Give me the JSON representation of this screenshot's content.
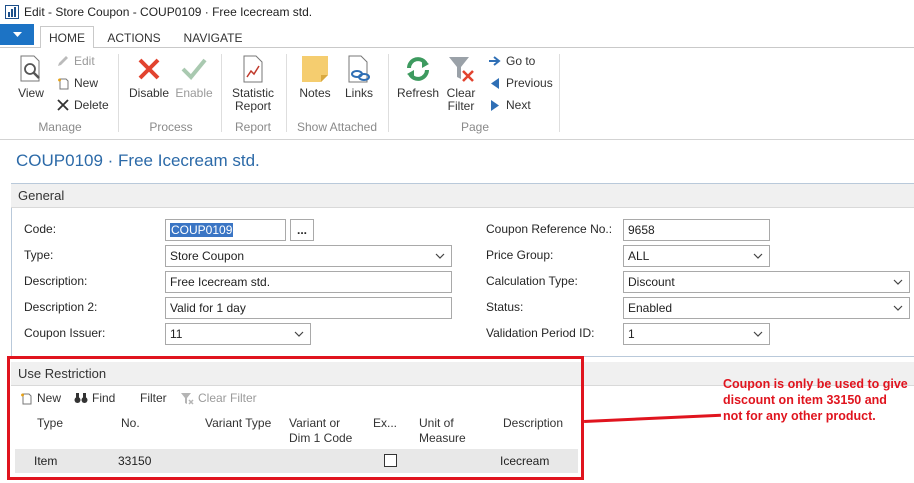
{
  "window": {
    "title": "Edit - Store Coupon - COUP0109 · Free Icecream std."
  },
  "tabs": [
    "HOME",
    "ACTIONS",
    "NAVIGATE"
  ],
  "ribbon": {
    "manage": {
      "view": "View",
      "edit": "Edit",
      "new": "New",
      "delete": "Delete",
      "group": "Manage"
    },
    "process": {
      "disable": "Disable",
      "enable": "Enable",
      "group": "Process"
    },
    "report": {
      "statistic_line1": "Statistic",
      "statistic_line2": "Report",
      "group": "Report"
    },
    "attached": {
      "notes": "Notes",
      "links": "Links",
      "group": "Show Attached"
    },
    "page": {
      "refresh": "Refresh",
      "clear_line1": "Clear",
      "clear_line2": "Filter",
      "goto": "Go to",
      "previous": "Previous",
      "next": "Next",
      "group": "Page"
    }
  },
  "page_title": "COUP0109 · Free Icecream std.",
  "general": {
    "header": "General",
    "code": {
      "label": "Code:",
      "value": "COUP0109"
    },
    "type": {
      "label": "Type:",
      "value": "Store Coupon"
    },
    "description": {
      "label": "Description:",
      "value": "Free Icecream std."
    },
    "description2": {
      "label": "Description 2:",
      "value": "Valid for 1 day"
    },
    "issuer": {
      "label": "Coupon Issuer:",
      "value": "11"
    },
    "ref_no": {
      "label": "Coupon Reference No.:",
      "value": "9658"
    },
    "price_group": {
      "label": "Price Group:",
      "value": "ALL"
    },
    "calc_type": {
      "label": "Calculation Type:",
      "value": "Discount"
    },
    "status": {
      "label": "Status:",
      "value": "Enabled"
    },
    "validation": {
      "label": "Validation Period ID:",
      "value": "1"
    },
    "dots": "..."
  },
  "use_restriction": {
    "header": "Use Restriction",
    "actions": {
      "new": "New",
      "find": "Find",
      "filter": "Filter",
      "clear_filter": "Clear Filter"
    },
    "columns": {
      "type": "Type",
      "no": "No.",
      "variant_type": "Variant Type",
      "variant_line1": "Variant or",
      "variant_line2": "Dim 1 Code",
      "ex": "Ex...",
      "uom_line1": "Unit of",
      "uom_line2": "Measure",
      "description": "Description"
    },
    "rows": [
      {
        "type": "Item",
        "no": "33150",
        "description": "Icecream"
      }
    ]
  },
  "annotation": "Coupon is only be used to give discount on item 33150 and not for any other product.",
  "colors": {
    "accent": "#1c73c5",
    "title_blue": "#2c6aa8",
    "annotation_red": "#e0141e"
  }
}
